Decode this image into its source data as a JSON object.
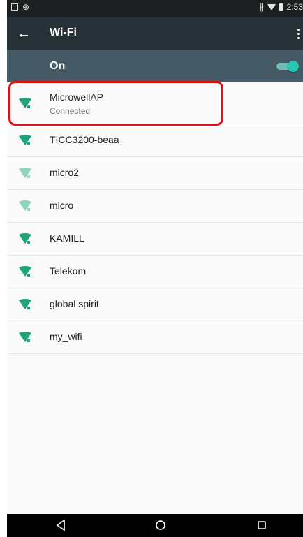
{
  "status_bar": {
    "time": "2:53",
    "left_icons": [
      "notification-doc-icon",
      "globe-icon"
    ],
    "right_icons": [
      "bluetooth-icon",
      "wifi-signal-icon",
      "battery-icon"
    ]
  },
  "app_bar": {
    "title": "Wi-Fi",
    "back_icon": "arrow-left-icon",
    "menu_icon": "more-vert-icon"
  },
  "switch_bar": {
    "label": "On",
    "enabled": true,
    "accent": "#26c6b2"
  },
  "networks": [
    {
      "name": "MicrowellAP",
      "status": "Connected",
      "signal": "full"
    },
    {
      "name": "TICC3200-beaa",
      "status": "",
      "signal": "full"
    },
    {
      "name": "micro2",
      "status": "",
      "signal": "weak"
    },
    {
      "name": "micro",
      "status": "",
      "signal": "weak"
    },
    {
      "name": "KAMILL",
      "status": "",
      "signal": "full"
    },
    {
      "name": "Telekom",
      "status": "",
      "signal": "full"
    },
    {
      "name": "global spirit",
      "status": "",
      "signal": "full"
    },
    {
      "name": "my_wifi",
      "status": "",
      "signal": "full"
    }
  ],
  "colors": {
    "status_bar": "#1d2021",
    "app_bar": "#263238",
    "switch_bar": "#455a64",
    "wifi_full": "#1fa37a",
    "wifi_weak": "#8fd3bb",
    "highlight": "#e01010"
  },
  "nav_bar": {
    "buttons": [
      "nav-back-icon",
      "nav-home-icon",
      "nav-recent-icon"
    ]
  }
}
